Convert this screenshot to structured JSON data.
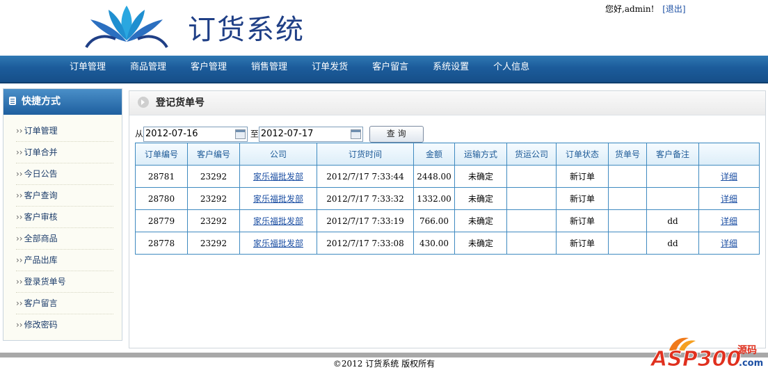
{
  "header": {
    "system_title": "订货系统",
    "greeting": "您好,admin!",
    "logout_label": "[退出]"
  },
  "nav": {
    "items": [
      "订单管理",
      "商品管理",
      "客户管理",
      "销售管理",
      "订单发货",
      "客户留言",
      "系统设置",
      "个人信息"
    ]
  },
  "sidebar": {
    "title": "快捷方式",
    "items": [
      "订单管理",
      "订单合并",
      "今日公告",
      "客户查询",
      "客户审核",
      "全部商品",
      "产品出库",
      "登录货单号",
      "客户留言",
      "修改密码"
    ]
  },
  "content": {
    "title": "登记货单号",
    "filter": {
      "from_label": "从",
      "from_date": "2012-07-16",
      "to_label": "至",
      "to_date": "2012-07-17",
      "query_label": "查 询"
    },
    "table": {
      "columns": [
        "订单编号",
        "客户编号",
        "公司",
        "订货时间",
        "金额",
        "运输方式",
        "货运公司",
        "订单状态",
        "货单号",
        "客户备注",
        ""
      ],
      "rows": [
        {
          "order_no": "28781",
          "customer_no": "23292",
          "company": "家乐福批发部",
          "time": "2012/7/17 7:33:44",
          "amount": "2448.00",
          "shipping": "未确定",
          "carrier": "",
          "status": "新订单",
          "waybill": "",
          "remark": "",
          "detail": "详细"
        },
        {
          "order_no": "28780",
          "customer_no": "23292",
          "company": "家乐福批发部",
          "time": "2012/7/17 7:33:32",
          "amount": "1332.00",
          "shipping": "未确定",
          "carrier": "",
          "status": "新订单",
          "waybill": "",
          "remark": "",
          "detail": "详细"
        },
        {
          "order_no": "28779",
          "customer_no": "23292",
          "company": "家乐福批发部",
          "time": "2012/7/17 7:33:19",
          "amount": "766.00",
          "shipping": "未确定",
          "carrier": "",
          "status": "新订单",
          "waybill": "",
          "remark": "dd",
          "detail": "详细"
        },
        {
          "order_no": "28778",
          "customer_no": "23292",
          "company": "家乐福批发部",
          "time": "2012/7/17 7:33:08",
          "amount": "430.00",
          "shipping": "未确定",
          "carrier": "",
          "status": "新订单",
          "waybill": "",
          "remark": "dd",
          "detail": "详细"
        }
      ]
    }
  },
  "footer": {
    "copyright": "©2012 订货系统 版权所有",
    "watermark": "ASP300源码.com"
  },
  "colors": {
    "nav_blue": "#1c5c9b",
    "table_border": "#3f8ac0",
    "header_text": "#1d5a97",
    "link": "#1c4fa3",
    "logo_blue": "#1f3f86"
  }
}
